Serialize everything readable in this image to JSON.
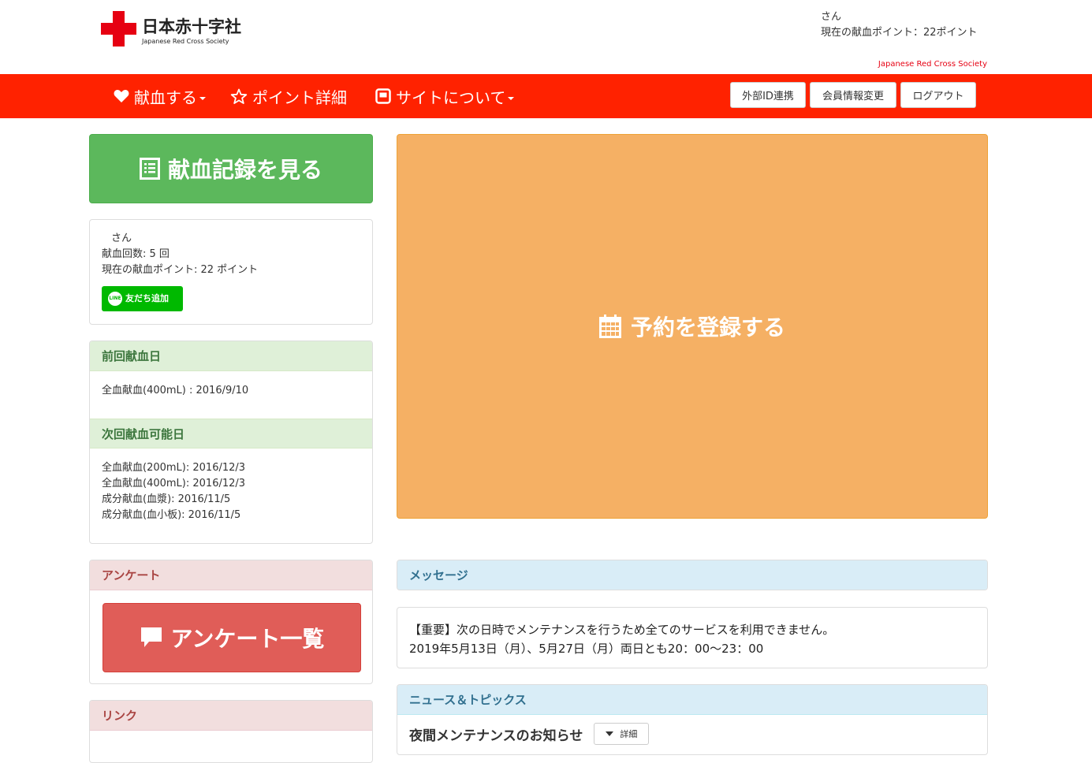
{
  "header": {
    "logo_jp": "日本赤十字社",
    "logo_en": "Japanese Red Cross Society",
    "user_name_suffix": "さん",
    "points_text": "現在の献血ポイント：22ポイント",
    "jrc_label": "Japanese Red Cross Society"
  },
  "nav": {
    "items": [
      {
        "label": "献血する",
        "icon": "heart-icon",
        "dropdown": true
      },
      {
        "label": "ポイント詳細",
        "icon": "star-icon",
        "dropdown": false
      },
      {
        "label": "サイトについて",
        "icon": "window-icon",
        "dropdown": true
      }
    ],
    "buttons": [
      "外部ID連携",
      "会員情報変更",
      "ログアウト"
    ]
  },
  "left": {
    "record_button": "献血記録を見る",
    "user": {
      "name_suffix": "さん",
      "count": "献血回数: 5 回",
      "points": "現在の献血ポイント: 22 ポイント",
      "line_button": "友だち追加",
      "line_icon_text": "LINE"
    },
    "last_donation": {
      "title": "前回献血日",
      "items": [
        "全血献血(400mL) : 2016/9/10"
      ]
    },
    "next_donation": {
      "title": "次回献血可能日",
      "items": [
        "全血献血(200mL): 2016/12/3",
        "全血献血(400mL): 2016/12/3",
        "成分献血(血漿): 2016/11/5",
        "成分献血(血小板): 2016/11/5"
      ]
    },
    "survey": {
      "title": "アンケート",
      "button": "アンケート一覧"
    },
    "links": {
      "title": "リンク"
    }
  },
  "right": {
    "reserve_button": "予約を登録する",
    "message": {
      "title": "メッセージ",
      "lines": [
        "【重要】次の日時でメンテナンスを行うため全てのサービスを利用できません。",
        "2019年5月13日（月）、5月27日（月）両日とも20：00～23：00"
      ]
    },
    "news": {
      "title": "ニュース＆トピックス",
      "item_title": "夜間メンテナンスのお知らせ",
      "detail_button": "詳細"
    }
  },
  "colors": {
    "navbar": "#ff2200",
    "brand_red": "#e60012",
    "success": "#5cb85c",
    "warning": "#f5b064",
    "danger": "#e05d58",
    "line_green": "#00b900"
  }
}
